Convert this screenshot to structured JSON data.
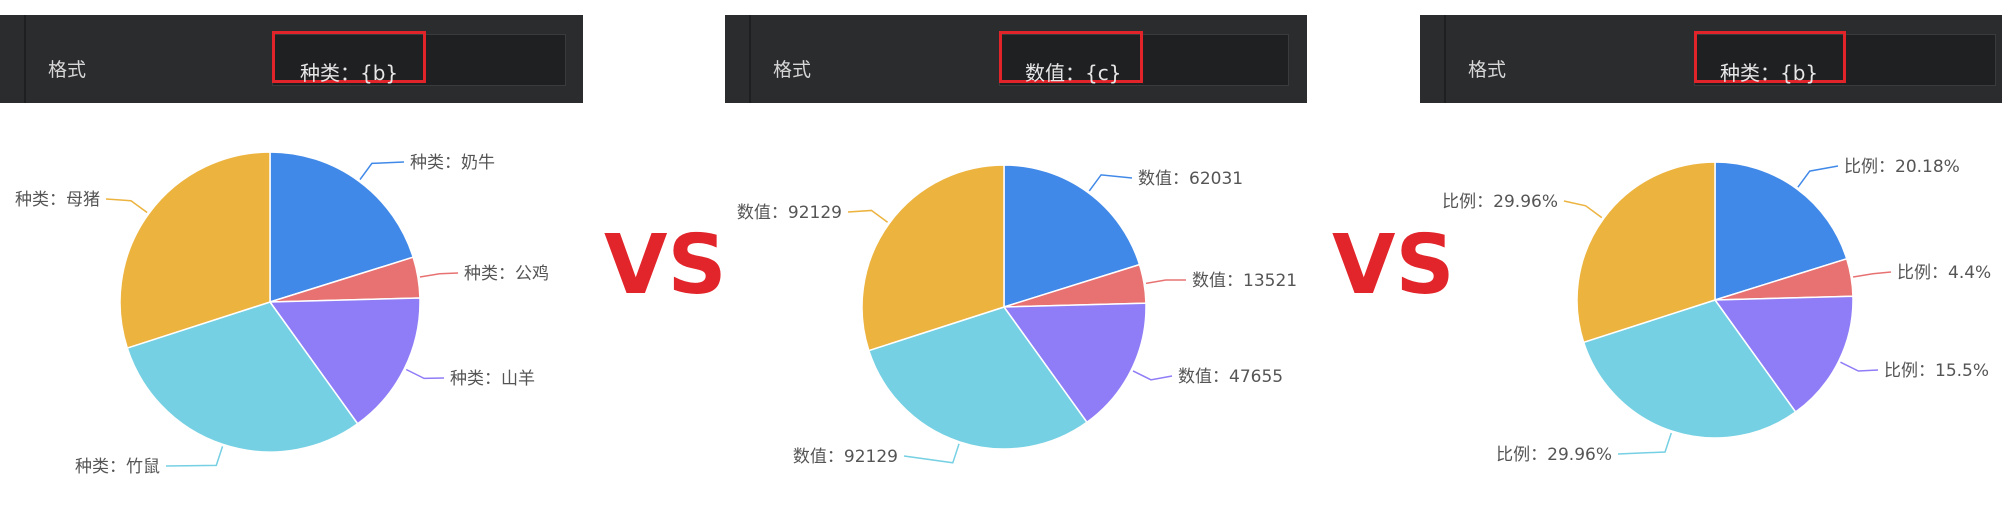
{
  "panels": [
    {
      "format_label": "格式",
      "format_value": "种类：{b}"
    },
    {
      "format_label": "格式",
      "format_value": "数值：{c}"
    },
    {
      "format_label": "格式",
      "format_value": "种类：{b}"
    }
  ],
  "vs_text": "VS",
  "colors": [
    "#4189e8",
    "#e87272",
    "#8f7cf7",
    "#75d0e3",
    "#ecb33f"
  ],
  "chart_data": [
    {
      "type": "pie",
      "title": "",
      "values": [
        62031,
        13521,
        47655,
        92129,
        92129
      ],
      "labels": [
        "种类：奶牛",
        "种类：公鸡",
        "种类：山羊",
        "种类：竹鼠",
        "种类：母猪"
      ]
    },
    {
      "type": "pie",
      "title": "",
      "values": [
        62031,
        13521,
        47655,
        92129,
        92129
      ],
      "labels": [
        "数值：62031",
        "数值：13521",
        "数值：47655",
        "数值：92129",
        "数值：92129"
      ]
    },
    {
      "type": "pie",
      "title": "",
      "values": [
        62031,
        13521,
        47655,
        92129,
        92129
      ],
      "labels": [
        "比例：20.18%",
        "比例：4.4%",
        "比例：15.5%",
        "比例：29.96%",
        "比例：29.96%"
      ]
    }
  ]
}
